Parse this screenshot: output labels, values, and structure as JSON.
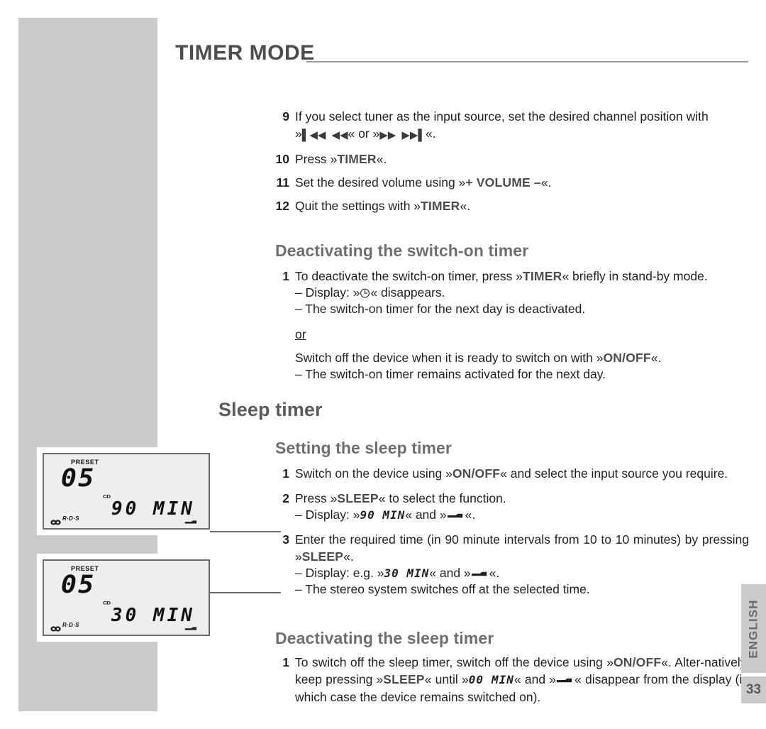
{
  "page": {
    "title": "TIMER MODE",
    "language_tab": "ENGLISH",
    "page_number": "33"
  },
  "steps_top": [
    {
      "num": "9",
      "text_before": "If you select tuner as the input source, set the desired channel position with ",
      "text_line2_prefix": "»",
      "icons": [
        "skip-back-icon",
        "rewind-icon",
        "fast-forward-icon",
        "skip-forward-icon"
      ],
      "text_line2_middle": "« or »",
      "text_line2_suffix": "«."
    },
    {
      "num": "10",
      "pre": "Press »",
      "kw": "TIMER",
      "post": "«."
    },
    {
      "num": "11",
      "pre": "Set the desired volume using »",
      "kw": "+ VOLUME –",
      "post": "«."
    },
    {
      "num": "12",
      "pre": "Quit the settings with »",
      "kw": "TIMER",
      "post": "«."
    }
  ],
  "deactivating_switch_on": {
    "heading": "Deactivating the switch-on timer",
    "step1_num": "1",
    "step1_pre": "To deactivate the switch-on timer, press »",
    "step1_kw": "TIMER",
    "step1_post": "« briefly in stand-by mode.",
    "bullet1_pre": "– Display: »",
    "bullet1_post": "« disappears.",
    "bullet2": "– The switch-on timer for the next day is deactivated.",
    "or": "or",
    "alt_pre": "Switch off the device when it is ready to switch on with »",
    "alt_kw": "ON/OFF",
    "alt_post": "«.",
    "alt_bullet": "– The switch-on timer remains activated for the next day."
  },
  "sleep_timer": {
    "heading": "Sleep timer",
    "setting": {
      "heading": "Setting the sleep timer",
      "step1_num": "1",
      "step1_pre": "Switch on the device using »",
      "step1_kw": "ON/OFF",
      "step1_post": "« and select the input source you require.",
      "step2_num": "2",
      "step2_pre": "Press »",
      "step2_kw": "SLEEP",
      "step2_post": "« to select the function.",
      "step2_bullet_pre": "– Display: »",
      "step2_bullet_lcd": "90 MIN",
      "step2_bullet_mid": "« and »",
      "step2_bullet_post": "«.",
      "step3_num": "3",
      "step3_pre": "Enter the required time (in 90 minute intervals from 10 to 10 minutes) by pressing »",
      "step3_kw": "SLEEP",
      "step3_post": "«.",
      "step3_bullet_pre": "– Display: e.g. »",
      "step3_bullet_lcd": "30 MIN",
      "step3_bullet_mid": "« and »",
      "step3_bullet_post": "«.",
      "step3_bullet2": "– The stereo system switches off at the selected time."
    },
    "deactivating": {
      "heading": "Deactivating the sleep timer",
      "step1_num": "1",
      "step1_a": "To switch off the sleep timer, switch off the device using »",
      "step1_kw1": "ON/OFF",
      "step1_b": "«. Alter-natively, keep pressing »",
      "step1_kw2": "SLEEP",
      "step1_c": "« until »",
      "step1_lcd": "00 MIN",
      "step1_d": "« and »",
      "step1_e": "« disappear from the display (in which case the device remains switched on)."
    }
  },
  "lcd_displays": [
    {
      "preset_label": "PRESET",
      "preset_value": "05",
      "source_label": "CD",
      "time_value": "90 MIN",
      "rds_label": "R·D·S"
    },
    {
      "preset_label": "PRESET",
      "preset_value": "05",
      "source_label": "CD",
      "time_value": "30 MIN",
      "rds_label": "R·D·S"
    }
  ],
  "colors": {
    "panel_gray": "#cbcbcb",
    "heading_gray": "#6f6f6f",
    "keyword_gray": "#4d4d4d",
    "body_black": "#231f20"
  }
}
